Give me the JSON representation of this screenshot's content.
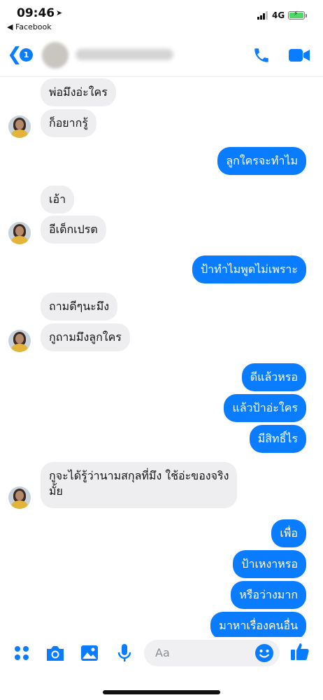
{
  "status_bar": {
    "time": "09:46",
    "back_app_label": "◀ Facebook",
    "network": "4G"
  },
  "header": {
    "unread_count": "1"
  },
  "messages": [
    {
      "side": "in",
      "text": "พ่อมึงอ่ะใคร"
    },
    {
      "side": "in",
      "text": "ก็อยากรู้"
    },
    {
      "side": "out",
      "text": "ลูกใครจะทำไม"
    },
    {
      "side": "in",
      "text": "เอ้า"
    },
    {
      "side": "in",
      "text": "อีเด็กเปรต"
    },
    {
      "side": "out",
      "text": "ป้าทำไมพูดไม่เพราะ"
    },
    {
      "side": "in",
      "text": "ถามดีๆนะมึง"
    },
    {
      "side": "in",
      "text": "กูถามมึงลูกใคร"
    },
    {
      "side": "out",
      "text": "ดีแล้วหรอ"
    },
    {
      "side": "out",
      "text": "แล้วป้าอ่ะใคร"
    },
    {
      "side": "out",
      "text": "มีสิทธิ์ไร"
    },
    {
      "side": "in",
      "text": "กูจะได้รู้ว่านามสกุลที่มึง ใช้อ่ะของจริง"
    },
    {
      "side": "in",
      "text": "มั้ย"
    },
    {
      "side": "out",
      "text": "เพื่อ"
    },
    {
      "side": "out",
      "text": "ป้าเหงาหรอ"
    },
    {
      "side": "out",
      "text": "หรือว่างมาก"
    },
    {
      "side": "out",
      "text": "มาหาเรื่องคนอื่น"
    }
  ],
  "composer": {
    "placeholder": "Aa"
  },
  "colors": {
    "accent": "#0a7cff",
    "incoming_bubble": "#eeeef0"
  },
  "icons": [
    "location-arrow-icon",
    "signal-icon",
    "battery-icon",
    "back-chevron-icon",
    "phone-icon",
    "video-camera-icon",
    "apps-grid-icon",
    "camera-icon",
    "gallery-icon",
    "microphone-icon",
    "emoji-icon",
    "thumbs-up-icon"
  ]
}
